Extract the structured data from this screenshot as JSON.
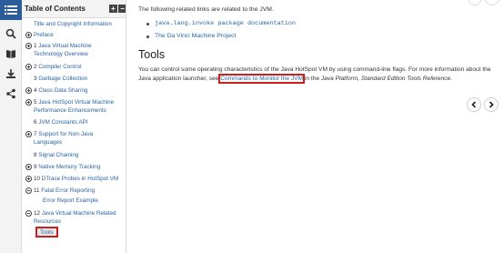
{
  "rail": {
    "items": [
      {
        "icon": "toc-icon",
        "active": true
      },
      {
        "icon": "search-icon",
        "active": false
      },
      {
        "icon": "book-icon",
        "active": false
      },
      {
        "icon": "download-icon",
        "active": false
      },
      {
        "icon": "share-icon",
        "active": false
      }
    ]
  },
  "toc": {
    "title": "Table of Contents",
    "expand_label": "+",
    "collapse_label": "−",
    "items": [
      {
        "num": "",
        "label": "Title and Copyright Information"
      },
      {
        "num": "",
        "label": "Preface"
      },
      {
        "num": "1 ",
        "label": "Java Virtual Machine Technology Overview"
      },
      {
        "num": "2 ",
        "label": "Compiler Control"
      },
      {
        "num": "3 ",
        "label": "Garbage Collection"
      },
      {
        "num": "4 ",
        "label": "Class Data Sharing"
      },
      {
        "num": "5 ",
        "label": "Java HotSpot Virtual Machine Performance Enhancements"
      },
      {
        "num": "6 ",
        "label": "JVM Constants API"
      },
      {
        "num": "7 ",
        "label": "Support for Non-Java Languages"
      },
      {
        "num": "8 ",
        "label": "Signal Chaining"
      },
      {
        "num": "9 ",
        "label": "Native Memory Tracking"
      },
      {
        "num": "10 ",
        "label": "DTrace Probes in HotSpot VM"
      },
      {
        "num": "11 ",
        "label": "Fatal Error Reporting"
      },
      {
        "num": "",
        "label": "Error Report Example"
      },
      {
        "num": "12 ",
        "label": "Java Virtual Machine Related Resources"
      },
      {
        "num": "",
        "label": "Tools"
      }
    ]
  },
  "main": {
    "intro": "The following related links are related to the JVM.",
    "links": [
      "java.lang.invoke package documentation",
      "The Da Vinci Machine Project"
    ],
    "heading": "Tools",
    "para_1": "You can control some operating characteristics of the Java HotSpot VM by using command-line flags. For more information about the Java application launcher, see ",
    "para_link": "Commands to Monitor the JVM",
    "para_2": " in the ",
    "para_italic": "Java Platform, Standard Edition Tools Reference",
    "para_3": ".",
    "prev_icon": "chevron-left-icon",
    "next_icon": "chevron-right-icon"
  },
  "colors": {
    "accent": "#2b5d9a",
    "link": "#2a64a6",
    "highlight_box": "#cc1f1f"
  }
}
